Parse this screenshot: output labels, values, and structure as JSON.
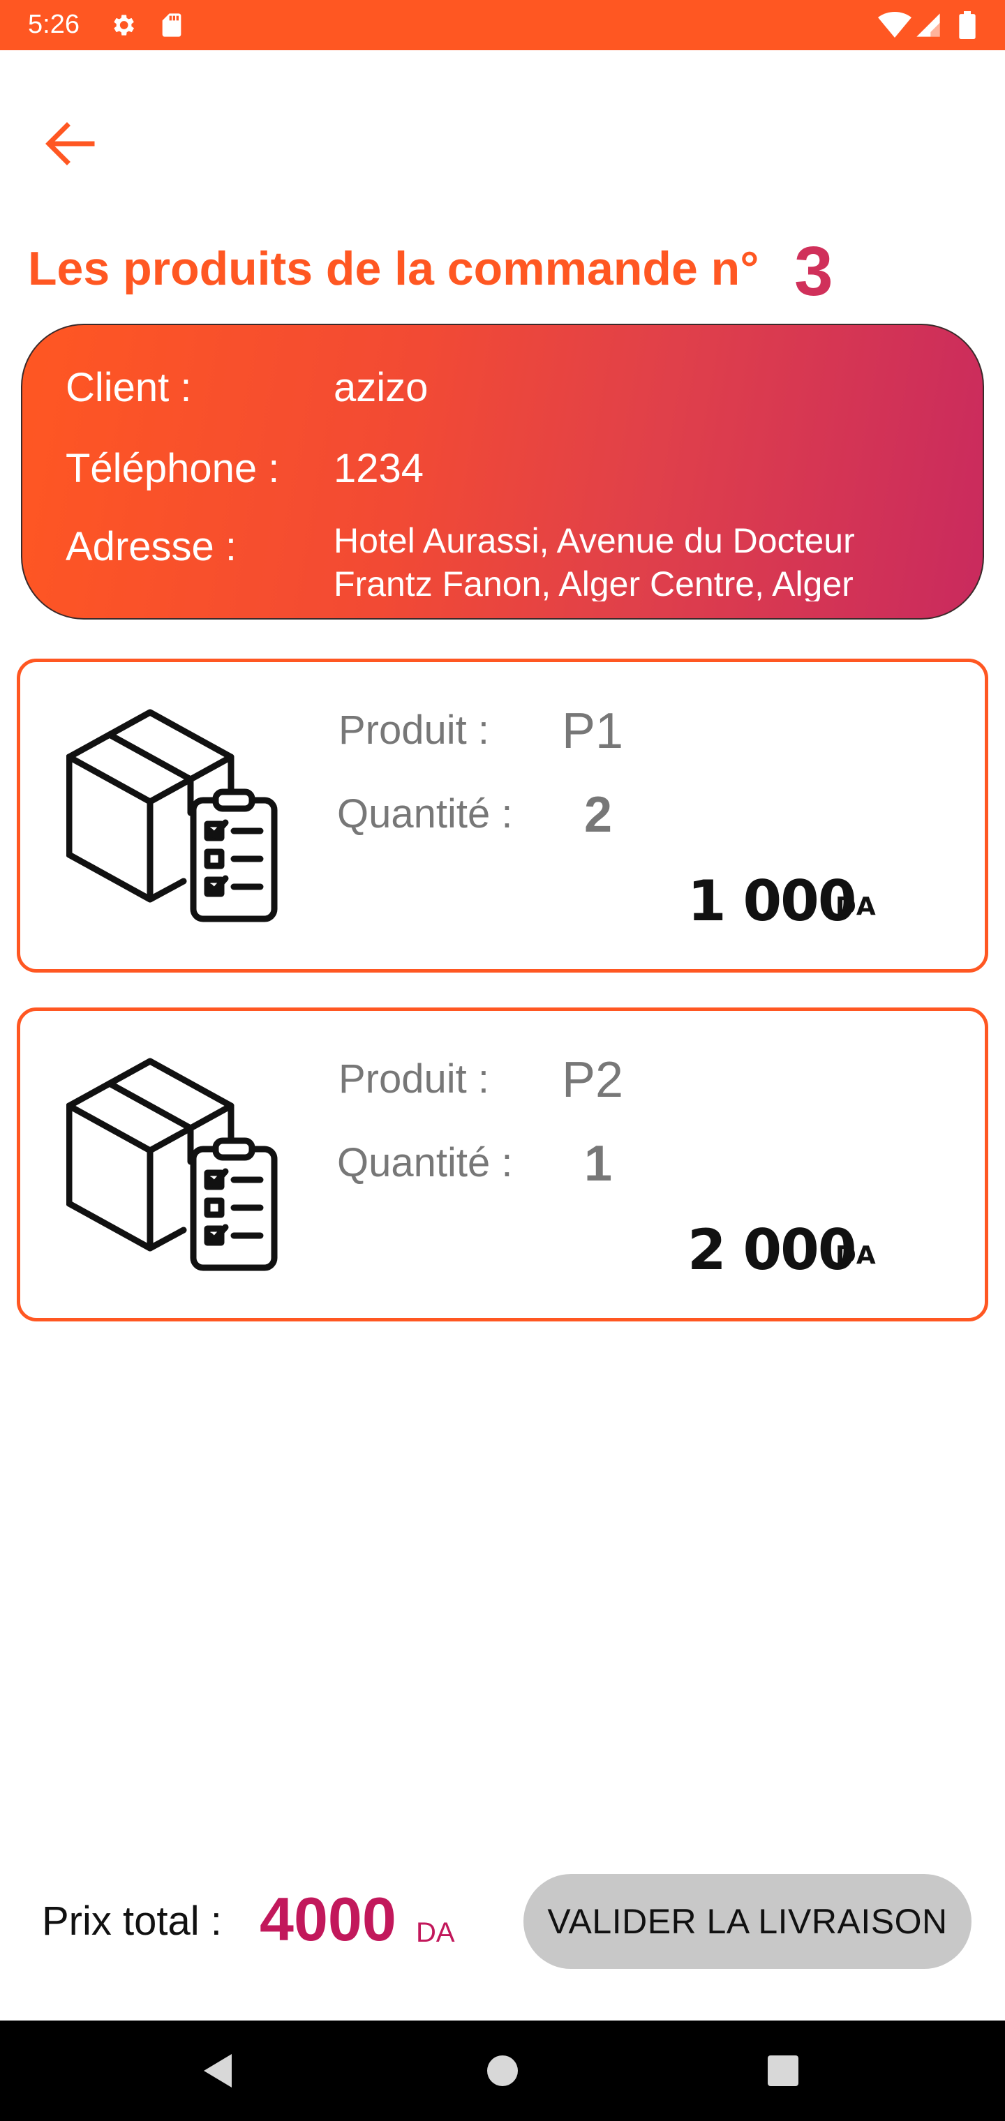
{
  "status_bar": {
    "time": "5:26",
    "icons": [
      "gear-icon",
      "sd-card-icon",
      "wifi-icon",
      "signal-icon",
      "battery-icon"
    ]
  },
  "header": {
    "back_icon": "arrow-left-icon",
    "title": "Les produits de la commande n°",
    "order_number": "3"
  },
  "client": {
    "client_label": "Client :",
    "client_value": "azizo",
    "phone_label": "Téléphone :",
    "phone_value": "1234",
    "address_label": "Adresse :",
    "address_value": "Hotel Aurassi, Avenue du Docteur Frantz Fanon, Alger Centre, Alger"
  },
  "products": [
    {
      "icon": "box-checklist-icon",
      "product_label": "Produit :",
      "product_name": "P1",
      "quantity_label": "Quantité :",
      "quantity": "2",
      "price": "1 000",
      "currency": "DA"
    },
    {
      "icon": "box-checklist-icon",
      "product_label": "Produit :",
      "product_name": "P2",
      "quantity_label": "Quantité :",
      "quantity": "1",
      "price": "2 000",
      "currency": "DA"
    }
  ],
  "footer": {
    "total_label": "Prix total :",
    "total_value": "4000",
    "total_currency": "DA",
    "validate_button": "VALIDER LA LIVRAISON"
  },
  "nav_bar": {
    "icons": [
      "back-triangle-icon",
      "home-circle-icon",
      "recents-square-icon"
    ]
  },
  "colors": {
    "primary": "#FF5722",
    "accent": "#C2185B",
    "gradient_end": "#C92A5E",
    "button_bg": "#C8C8C8",
    "muted_text": "#777777"
  }
}
